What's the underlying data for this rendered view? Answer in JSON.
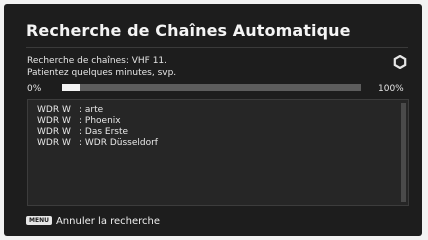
{
  "header": {
    "title": "Recherche de Chaînes Automatique"
  },
  "status": {
    "line1": "Recherche de chaînes: VHF 11.",
    "line2": "Patientez quelques minutes, svp.",
    "icon": "spinner-icon"
  },
  "progress": {
    "start_label": "0%",
    "end_label": "100%",
    "value_percent": 6
  },
  "channels": [
    {
      "network": "WDR W",
      "name": ": arte"
    },
    {
      "network": "WDR W",
      "name": ": Phoenix"
    },
    {
      "network": "WDR W",
      "name": ": Das Erste"
    },
    {
      "network": "WDR W",
      "name": ": WDR Düsseldorf"
    }
  ],
  "footer": {
    "key_label": "MENU",
    "action_label": "Annuler la recherche"
  }
}
